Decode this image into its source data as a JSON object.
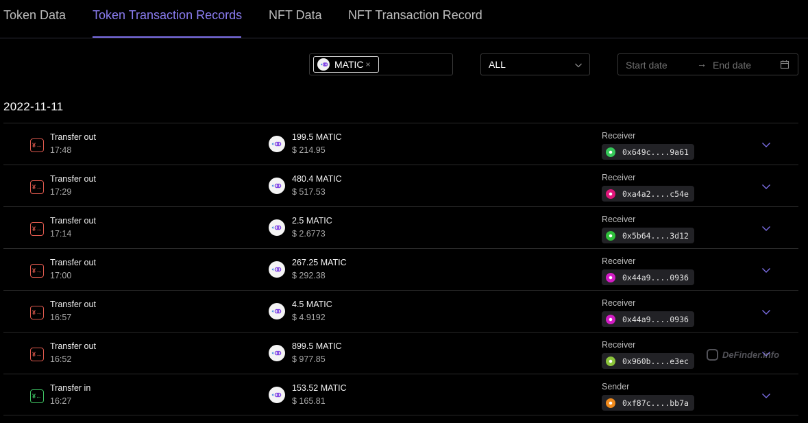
{
  "tabs": [
    {
      "label": "Token Data",
      "active": false
    },
    {
      "label": "Token Transaction Records",
      "active": true
    },
    {
      "label": "NFT Data",
      "active": false
    },
    {
      "label": "NFT Transaction Record",
      "active": false
    }
  ],
  "filters": {
    "token_tag": "MATIC",
    "token_tag_close": "×",
    "type_value": "ALL",
    "start_placeholder": "Start date",
    "end_placeholder": "End date",
    "range_arrow": "→"
  },
  "date_heading": "2022-11-11",
  "records": [
    {
      "type": "Transfer out",
      "direction": "out",
      "icon_glyph": "¥→",
      "time": "17:48",
      "amount": "199.5 MATIC",
      "value": "$ 214.95",
      "party_label": "Receiver",
      "address": "0x649c....9a61",
      "avatar_color": "#35c759"
    },
    {
      "type": "Transfer out",
      "direction": "out",
      "icon_glyph": "¥→",
      "time": "17:29",
      "amount": "480.4 MATIC",
      "value": "$ 517.53",
      "party_label": "Receiver",
      "address": "0xa4a2....c54e",
      "avatar_color": "#e0157a"
    },
    {
      "type": "Transfer out",
      "direction": "out",
      "icon_glyph": "¥→",
      "time": "17:14",
      "amount": "2.5 MATIC",
      "value": "$ 2.6773",
      "party_label": "Receiver",
      "address": "0x5b64....3d12",
      "avatar_color": "#2fbf3a"
    },
    {
      "type": "Transfer out",
      "direction": "out",
      "icon_glyph": "¥→",
      "time": "17:00",
      "amount": "267.25 MATIC",
      "value": "$ 292.38",
      "party_label": "Receiver",
      "address": "0x44a9....0936",
      "avatar_color": "#d21cc4"
    },
    {
      "type": "Transfer out",
      "direction": "out",
      "icon_glyph": "¥→",
      "time": "16:57",
      "amount": "4.5 MATIC",
      "value": "$ 4.9192",
      "party_label": "Receiver",
      "address": "0x44a9....0936",
      "avatar_color": "#d21cc4"
    },
    {
      "type": "Transfer out",
      "direction": "out",
      "icon_glyph": "¥→",
      "time": "16:52",
      "amount": "899.5 MATIC",
      "value": "$ 977.85",
      "party_label": "Receiver",
      "address": "0x960b....e3ec",
      "avatar_color": "#8bc43a"
    },
    {
      "type": "Transfer in",
      "direction": "in",
      "icon_glyph": "¥←",
      "time": "16:27",
      "amount": "153.52 MATIC",
      "value": "$ 165.81",
      "party_label": "Sender",
      "address": "0xf87c....bb7a",
      "avatar_color": "#f08a1c"
    }
  ],
  "watermark": "DeFinder.info",
  "colors": {
    "accent": "#7b6ee6",
    "transfer_out": "#e05a4e",
    "transfer_in": "#3fc564"
  },
  "icons": {
    "expand": "chevron-down-icon",
    "select": "chevron-down-icon",
    "calendar": "calendar-icon",
    "token": "polygon-matic-icon"
  }
}
